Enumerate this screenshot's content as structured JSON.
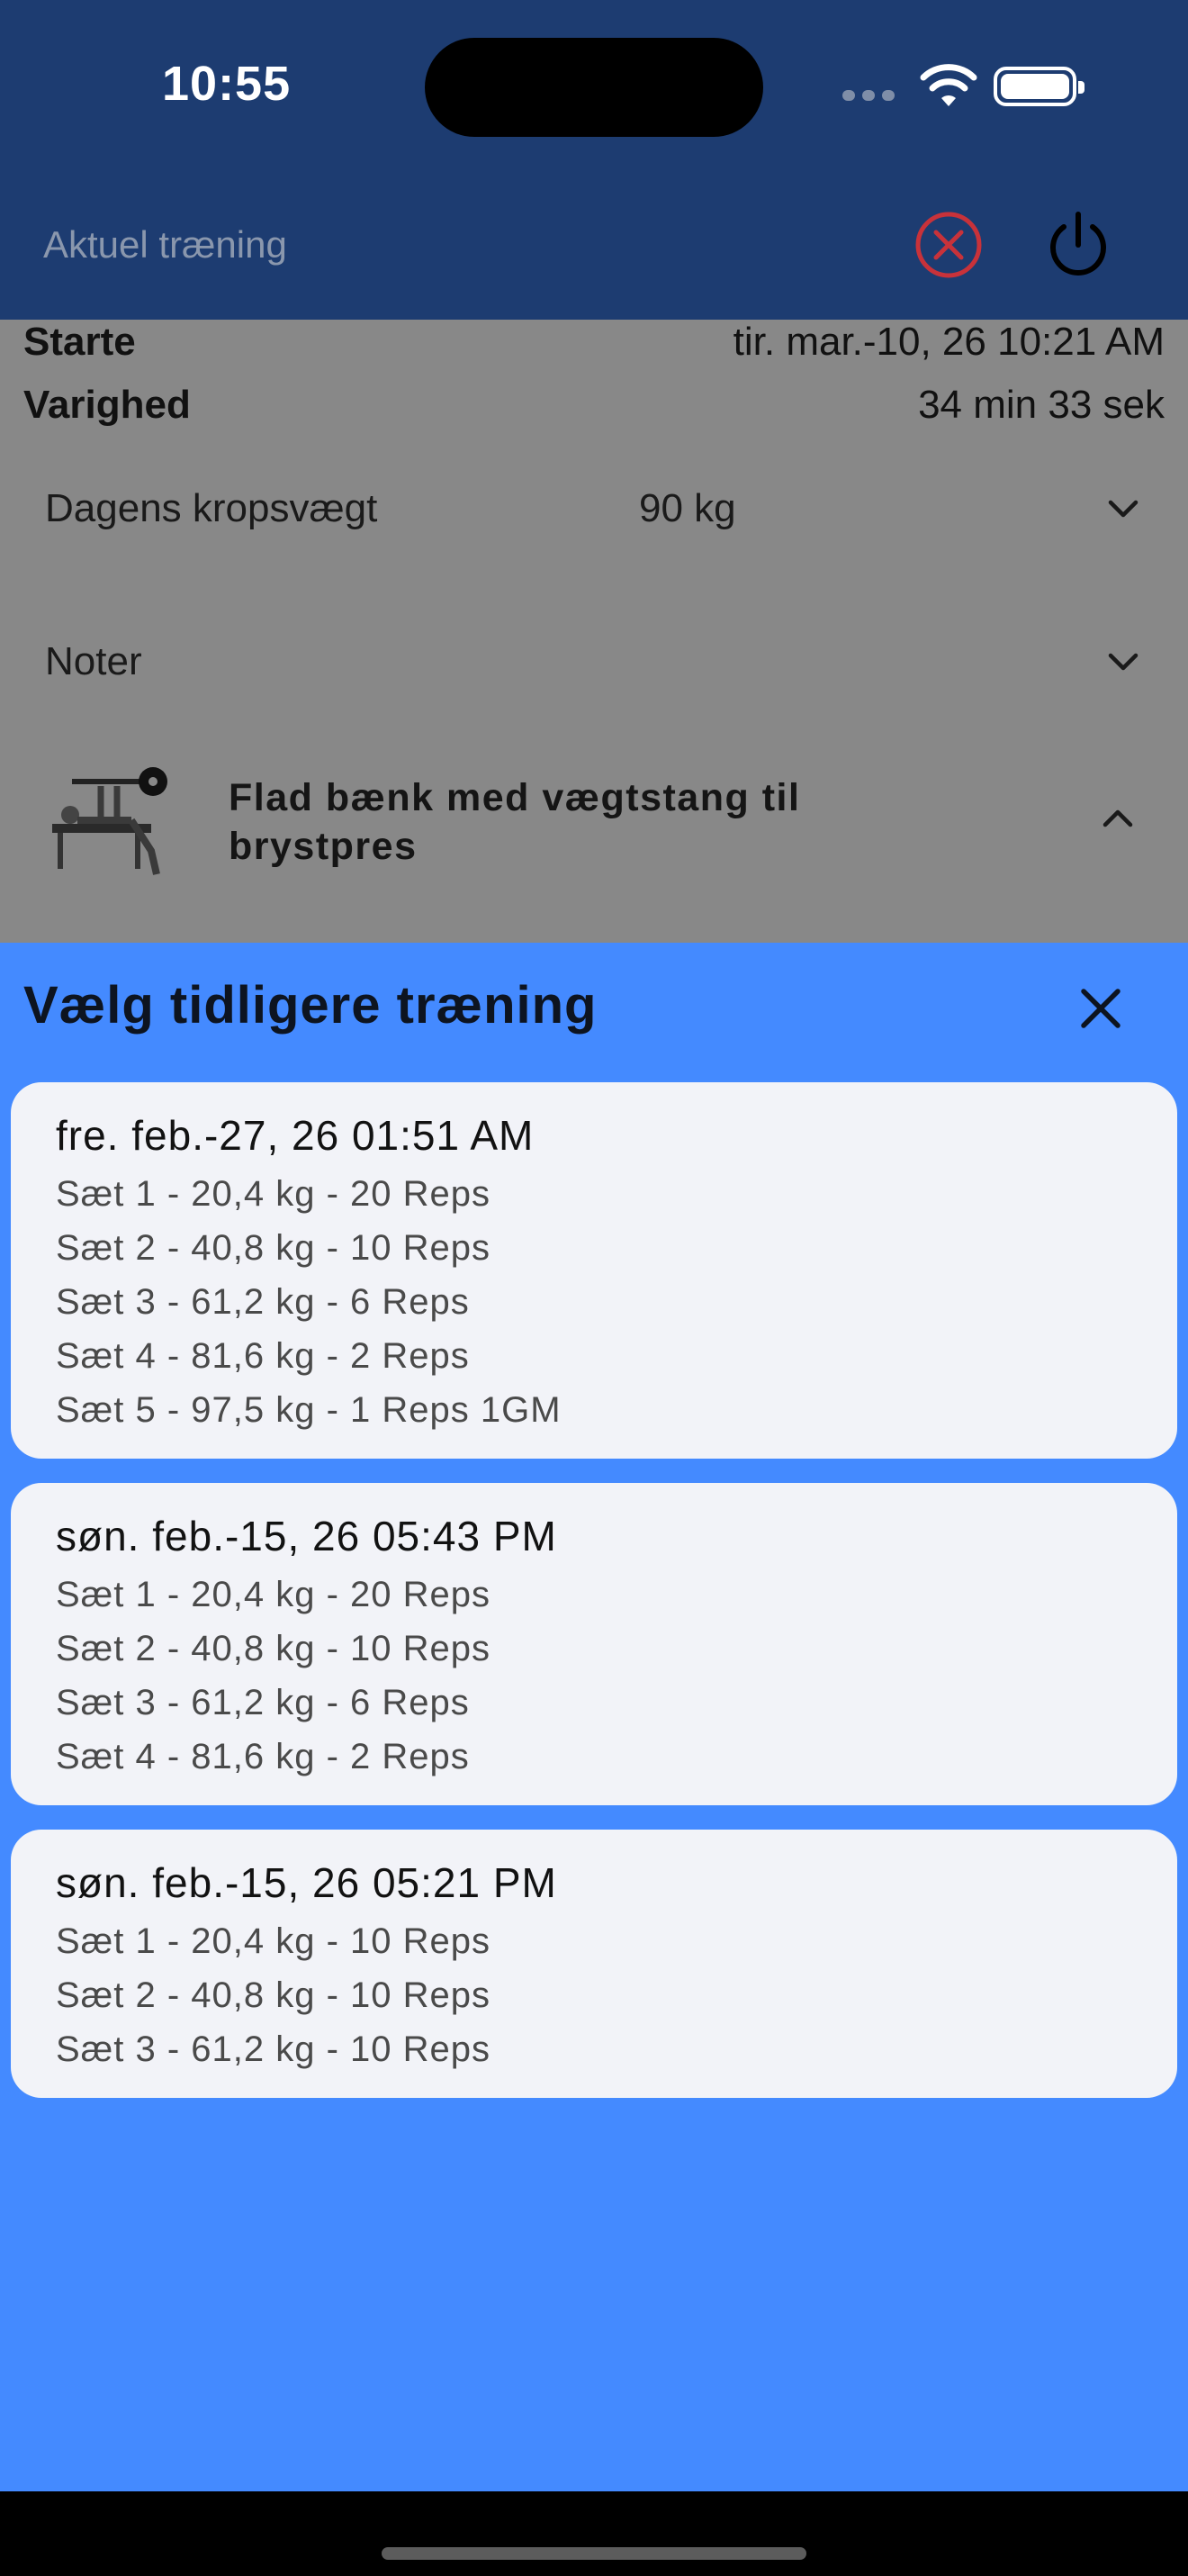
{
  "status_bar": {
    "time": "10:55"
  },
  "nav": {
    "title": "Aktuel træning"
  },
  "workout": {
    "start_label": "Starte",
    "start_value": "tir. mar.-10, 26 10:21 AM",
    "duration_label": "Varighed",
    "duration_value": "34 min 33 sek",
    "bodyweight_label": "Dagens kropsvægt",
    "bodyweight_value": "90 kg",
    "notes_label": "Noter",
    "exercise_title": "Flad bænk med vægtstang til brystpres"
  },
  "sheet": {
    "title": "Vælg tidligere træning",
    "sessions": [
      {
        "date": "fre. feb.-27, 26 01:51 AM",
        "sets": [
          "Sæt 1 - 20,4 kg - 20 Reps",
          "Sæt 2 - 40,8 kg - 10 Reps",
          "Sæt 3 - 61,2 kg - 6 Reps",
          "Sæt 4 - 81,6 kg - 2 Reps",
          "Sæt 5 - 97,5 kg - 1 Reps 1GM"
        ]
      },
      {
        "date": "søn. feb.-15, 26 05:43 PM",
        "sets": [
          "Sæt 1 - 20,4 kg - 20 Reps",
          "Sæt 2 - 40,8 kg - 10 Reps",
          "Sæt 3 - 61,2 kg - 6 Reps",
          "Sæt 4 - 81,6 kg - 2 Reps"
        ]
      },
      {
        "date": "søn. feb.-15, 26 05:21 PM",
        "sets": [
          "Sæt 1 - 20,4 kg - 10 Reps",
          "Sæt 2 - 40,8 kg - 10 Reps",
          "Sæt 3 - 61,2 kg - 10 Reps"
        ]
      }
    ]
  },
  "icons": {
    "cancel": "x-circle-icon",
    "power": "power-icon",
    "close": "close-icon",
    "chevron_down": "chevron-down-icon",
    "chevron_up": "chevron-up-icon"
  },
  "colors": {
    "nav_bg": "#1d3c71",
    "sheet_bg": "#448aff",
    "cancel_red": "#c8323a",
    "card_bg": "#f2f3f8"
  }
}
